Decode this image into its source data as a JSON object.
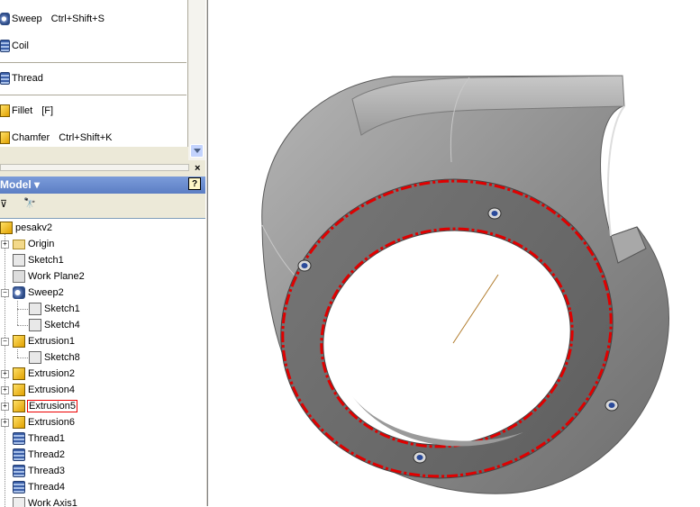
{
  "panel": {
    "commands": [
      {
        "label": "Sweep",
        "shortcut": "Ctrl+Shift+S",
        "icon": "sweep-icon"
      },
      {
        "label": "Coil",
        "shortcut": "",
        "icon": "coil-icon"
      },
      {
        "label": "Thread",
        "shortcut": "",
        "icon": "thread-icon"
      },
      {
        "label": "Fillet",
        "shortcut": "[F]",
        "icon": "fillet-icon"
      },
      {
        "label": "Chamfer",
        "shortcut": "Ctrl+Shift+K",
        "icon": "chamfer-icon"
      }
    ],
    "close_glyph": "×"
  },
  "browser": {
    "title": "Model ▾",
    "help_glyph": "?",
    "filter_glyph": "⊽",
    "find_glyph": "🔭",
    "tree": [
      {
        "label": "pesakv2",
        "icon": "part-icon",
        "depth": 0
      },
      {
        "label": "Origin",
        "icon": "folder-icon",
        "depth": 1
      },
      {
        "label": "Sketch1",
        "icon": "sketch-icon",
        "depth": 1
      },
      {
        "label": "Work Plane2",
        "icon": "workplane-icon",
        "depth": 1
      },
      {
        "label": "Sweep2",
        "icon": "sweep-icon",
        "depth": 1
      },
      {
        "label": "Sketch1",
        "icon": "sketch-icon",
        "depth": 2
      },
      {
        "label": "Sketch4",
        "icon": "sketch-icon",
        "depth": 2
      },
      {
        "label": "Extrusion1",
        "icon": "extrusion-icon",
        "depth": 1
      },
      {
        "label": "Sketch8",
        "icon": "sketch-icon",
        "depth": 2
      },
      {
        "label": "Extrusion2",
        "icon": "extrusion-icon",
        "depth": 1
      },
      {
        "label": "Extrusion4",
        "icon": "extrusion-icon",
        "depth": 1
      },
      {
        "label": "Extrusion5",
        "icon": "extrusion-icon",
        "depth": 1,
        "selected": true
      },
      {
        "label": "Extrusion6",
        "icon": "extrusion-icon",
        "depth": 1
      },
      {
        "label": "Thread1",
        "icon": "thread-icon",
        "depth": 1
      },
      {
        "label": "Thread2",
        "icon": "thread-icon",
        "depth": 1
      },
      {
        "label": "Thread3",
        "icon": "thread-icon",
        "depth": 1
      },
      {
        "label": "Thread4",
        "icon": "thread-icon",
        "depth": 1
      },
      {
        "label": "Work Axis1",
        "icon": "workaxis-icon",
        "depth": 1
      }
    ]
  },
  "colors": {
    "highlight": "#e00000",
    "model_body": "#8c8c8c",
    "header_blue": "#6a8ad0"
  }
}
